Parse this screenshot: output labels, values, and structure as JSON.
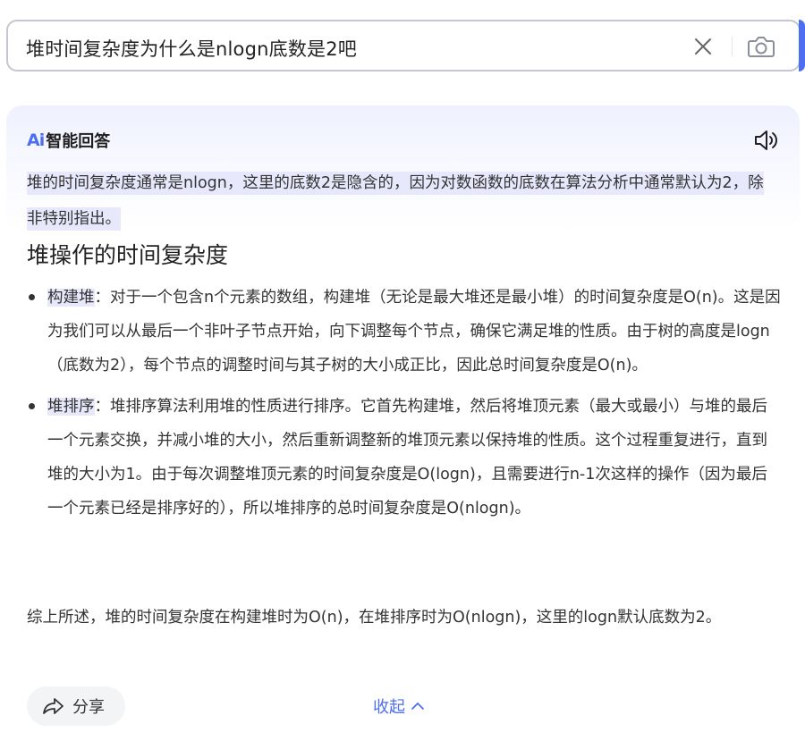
{
  "search": {
    "query": "堆时间复杂度为什么是nlogn底数是2吧",
    "clear_icon": "close-icon",
    "camera_icon": "camera-icon",
    "accent_color": "#4e6ef2"
  },
  "answer": {
    "badge_logo": "Ai",
    "badge_title": "智能回答",
    "speaker_icon": "speaker-icon",
    "summary": "堆的时间复杂度通常是nlogn，这里的底数2是隐含的，因为对数函数的底数在算法分析中通常默认为2，除非特别指出。",
    "section_title": "堆操作的时间复杂度",
    "bullets": [
      {
        "term": "构建堆",
        "text": "：对于一个包含n个元素的数组，构建堆（无论是最大堆还是最小堆）的时间复杂度是O(n)。这是因为我们可以从最后一个非叶子节点开始，向下调整每个节点，确保它满足堆的性质。由于树的高度是logn（底数为2），每个节点的调整时间与其子树的大小成正比，因此总时间复杂度是O(n)。"
      },
      {
        "term": "堆排序",
        "text": "：堆排序算法利用堆的性质进行排序。它首先构建堆，然后将堆顶元素（最大或最小）与堆的最后一个元素交换，并减小堆的大小，然后重新调整新的堆顶元素以保持堆的性质。这个过程重复进行，直到堆的大小为1。由于每次调整堆顶元素的时间复杂度是O(logn)，且需要进行n-1次这样的操作（因为最后一个元素已经是排序好的），所以堆排序的总时间复杂度是O(nlogn)。"
      }
    ],
    "conclusion": "综上所述，堆的时间复杂度在构建堆时为O(n)，在堆排序时为O(nlogn)，这里的logn默认底数为2。",
    "share_label": "分享",
    "share_icon": "share-icon",
    "collapse_label": "收起",
    "collapse_icon": "chevron-up-icon",
    "highlight_color": "#e8e8fd"
  }
}
